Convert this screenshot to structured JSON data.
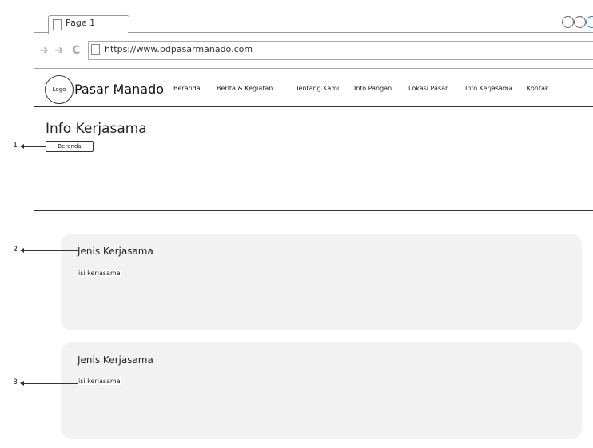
{
  "browser": {
    "tab_title": "Page 1",
    "url": "https://www.pdpasarmanado.com"
  },
  "header": {
    "logo_label": "Logo",
    "brand": "Pasar Manado",
    "menu": [
      "Beranda",
      "Berita & Kegiatan",
      "Tentang Kami",
      "Info Pangan",
      "Lokasi Pasar",
      "Info Kerjasama",
      "Kontak"
    ]
  },
  "page": {
    "title": "Info Kerjasama",
    "breadcrumb": "Beranda"
  },
  "cards": [
    {
      "title": "Jenis Kerjasama",
      "text": "isi kerjasama"
    },
    {
      "title": "Jenis Kerjasama",
      "text": "isi kerjasama"
    }
  ],
  "annotations": [
    "1",
    "2",
    "3"
  ]
}
